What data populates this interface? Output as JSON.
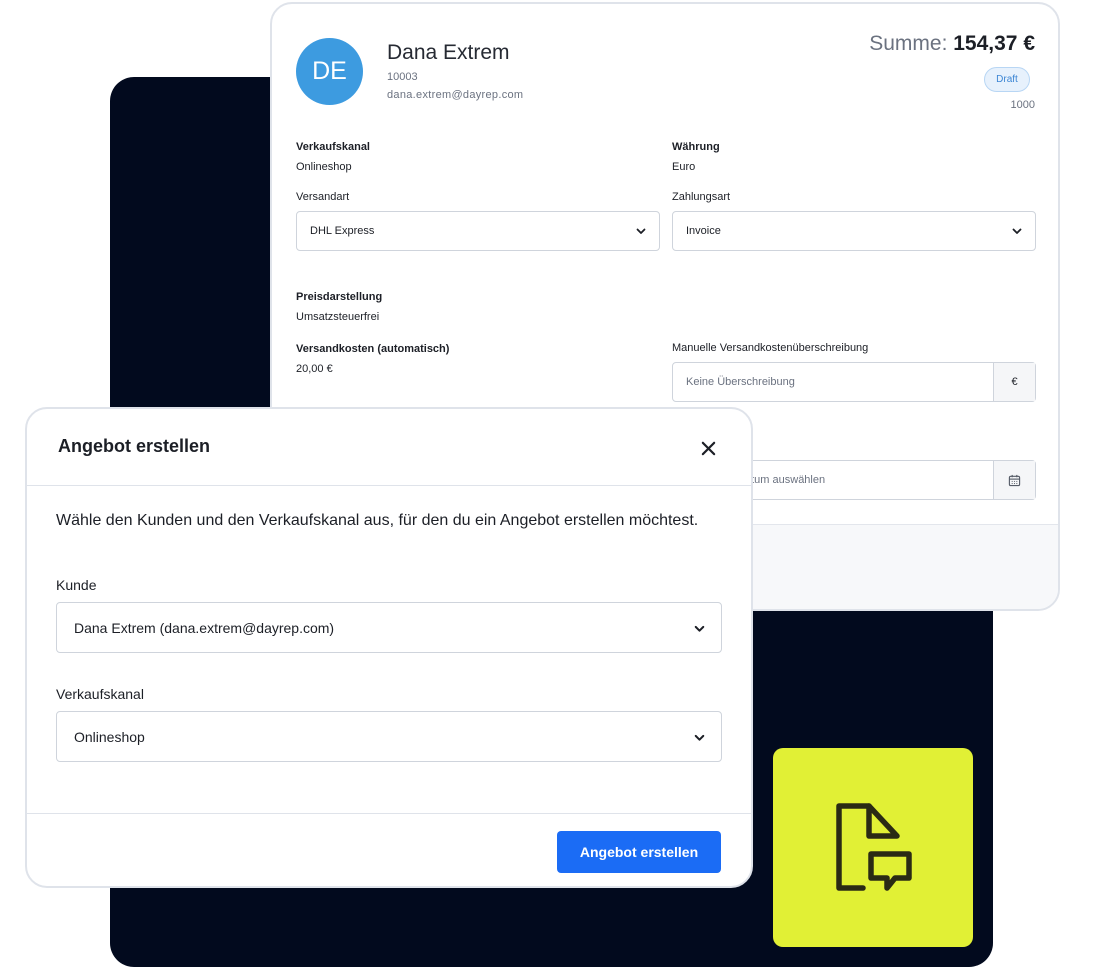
{
  "order": {
    "avatar_initials": "DE",
    "avatar_color": "#3d9be0",
    "customer_name": "Dana Extrem",
    "customer_number": "10003",
    "customer_email": "dana.extrem@dayrep.com",
    "total_label": "Summe:",
    "total_value": "154,37 €",
    "status_badge": "Draft",
    "order_number": "1000",
    "sales_channel_label": "Verkaufskanal",
    "sales_channel_value": "Onlineshop",
    "currency_label": "Währung",
    "currency_value": "Euro",
    "shipping_method_label": "Versandart",
    "shipping_method_value": "DHL Express",
    "payment_method_label": "Zahlungsart",
    "payment_method_value": "Invoice",
    "price_display_label": "Preisdarstellung",
    "price_display_value": "Umsatzsteuerfrei",
    "shipping_cost_label": "Versandkosten (automatisch)",
    "shipping_cost_value": "20,00 €",
    "manual_override_label": "Manuelle Versandkostenüberschreibung",
    "manual_override_placeholder": "Keine Überschreibung",
    "currency_addon": "€",
    "date_placeholder": "atum auswählen"
  },
  "modal": {
    "title": "Angebot erstellen",
    "description": "Wähle den Kunden und den Verkaufskanal aus, für den du ein Angebot erstellen möchtest.",
    "customer_label": "Kunde",
    "customer_value": "Dana Extrem (dana.extrem@dayrep.com)",
    "channel_label": "Verkaufskanal",
    "channel_value": "Onlineshop",
    "submit_label": "Angebot erstellen",
    "accent_color": "#1b6cf5"
  },
  "decor": {
    "panel_color": "#020a1e",
    "tile_color": "#e1f035",
    "tile_icon": "document-comment-icon"
  }
}
